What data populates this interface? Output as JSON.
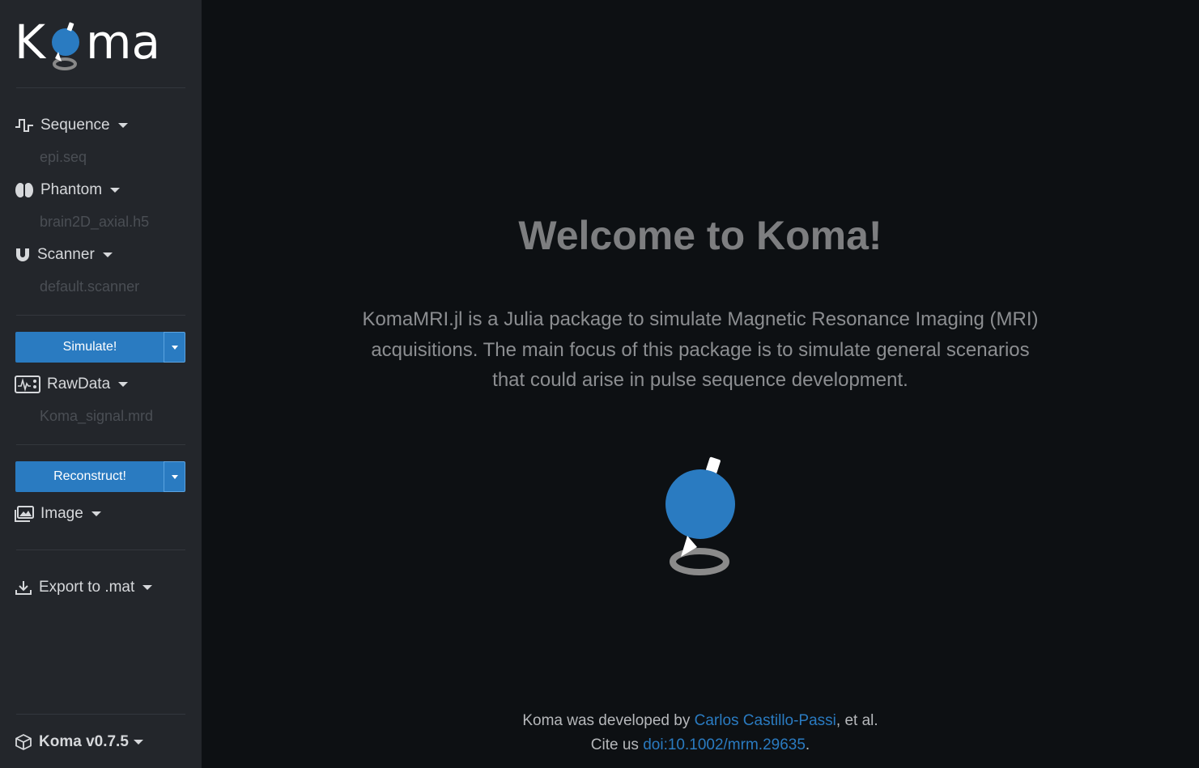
{
  "app": {
    "logo_text": "Koma",
    "version_label": "Koma v0.7.5"
  },
  "sidebar": {
    "sequence": {
      "label": "Sequence",
      "file": "epi.seq"
    },
    "phantom": {
      "label": "Phantom",
      "file": "brain2D_axial.h5"
    },
    "scanner": {
      "label": "Scanner",
      "file": "default.scanner"
    },
    "simulate_button": "Simulate!",
    "rawdata": {
      "label": "RawData",
      "file": "Koma_signal.mrd"
    },
    "reconstruct_button": "Reconstruct!",
    "image": {
      "label": "Image"
    },
    "export": {
      "label": "Export to .mat"
    }
  },
  "main": {
    "title": "Welcome to Koma!",
    "description": "KomaMRI.jl is a Julia package to simulate Magnetic Resonance Imaging (MRI) acquisitions. The main focus of this package is to simulate general scenarios that could arise in pulse sequence development.",
    "footer": {
      "developed_prefix": "Koma was developed by ",
      "author_link": "Carlos Castillo-Passi",
      "developed_suffix": ", et al.",
      "cite_prefix": "Cite us ",
      "doi_link": "doi:10.1002/mrm.29635",
      "cite_suffix": "."
    }
  },
  "colors": {
    "sidebar_bg": "#23262b",
    "main_bg": "#0d1013",
    "accent": "#2a7bc1"
  },
  "icons": {
    "sequence": "pulse-sequence-icon",
    "phantom": "brain-icon",
    "scanner": "magnet-icon",
    "rawdata": "signal-monitor-icon",
    "image": "images-icon",
    "export": "download-icon",
    "version": "cube-icon"
  }
}
